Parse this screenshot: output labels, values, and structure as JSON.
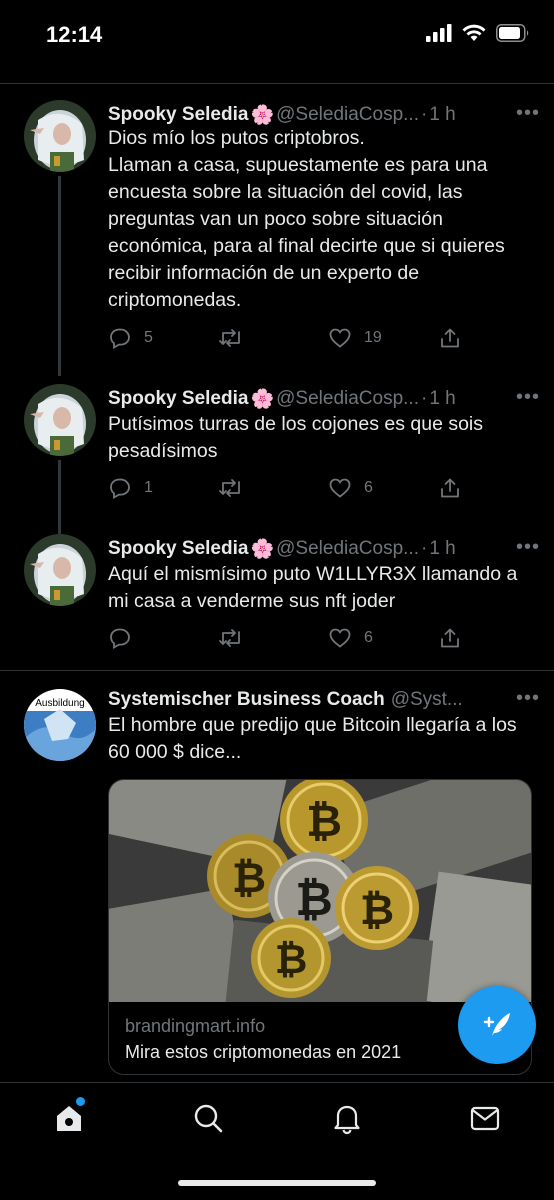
{
  "status_bar": {
    "time": "12:14"
  },
  "tweets": [
    {
      "name": "Spooky Seledia",
      "emoji": "🌸",
      "handle": "@SelediaCosp...",
      "sep": "·",
      "time": "1 h",
      "text": "Dios mío los putos criptobros.\nLlaman a casa, supuestamente es para una encuesta sobre la situación del covid, las preguntas van un poco sobre situación económica, para al final decirte que si quieres recibir información de un experto de criptomonedas.",
      "replies": "5",
      "retweets": "",
      "likes": "19"
    },
    {
      "name": "Spooky Seledia",
      "emoji": "🌸",
      "handle": "@SelediaCosp...",
      "sep": "·",
      "time": "1 h",
      "text": "Putísimos turras de los cojones es que sois pesadísimos",
      "replies": "1",
      "retweets": "",
      "likes": "6"
    },
    {
      "name": "Spooky Seledia",
      "emoji": "🌸",
      "handle": "@SelediaCosp...",
      "sep": "·",
      "time": "1 h",
      "text": "Aquí el mismísimo puto W1LLYR3X llamando a mi casa a venderme sus nft joder",
      "replies": "",
      "retweets": "",
      "likes": "6"
    },
    {
      "name": "Systemischer Business Coach",
      "handle": "@Syst...",
      "avatar_text": "Ausbildung",
      "text": "El hombre que predijo que Bitcoin llegaría a los 60 000 $ dice...",
      "card": {
        "domain": "brandingmart.info",
        "title": "Mira estos criptomonedas en 2021"
      }
    }
  ],
  "colors": {
    "accent": "#1d9bf0",
    "muted": "#71767b",
    "text": "#e7e9ea",
    "border": "#2f3336"
  }
}
